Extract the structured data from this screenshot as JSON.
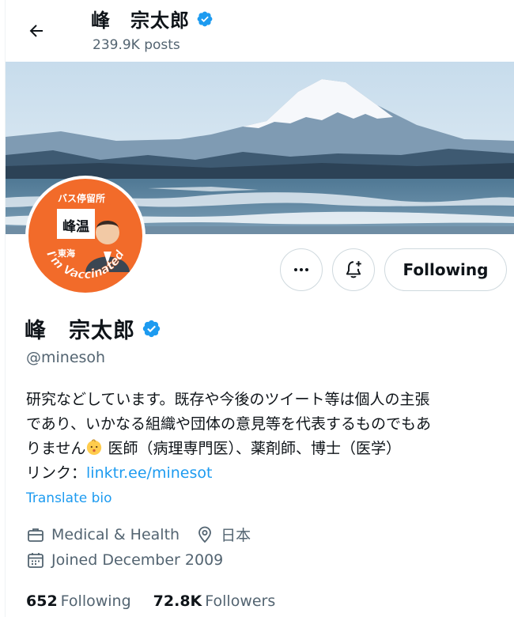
{
  "header": {
    "name": "峰　宗太郎",
    "posts": "239.9K posts"
  },
  "banner": {
    "description": ""
  },
  "avatar": {
    "sign_top": "バス停留所",
    "sign_name": "峰温",
    "sign_sub": "東海",
    "badge": "I'm Vaccinated"
  },
  "actions": {
    "following_label": "Following"
  },
  "profile": {
    "name": "峰　宗太郎",
    "handle": "@minesoh",
    "bio_line1": "研究などしています。既存や今後のツイート等は個人の主張",
    "bio_line2": "であり、いかなる組織や団体の意見等を代表するものでもあ",
    "bio_line3a": "りません",
    "bio_line3b": " 医師（病理専門医）、薬剤師、博士（医学）",
    "bio_line4a": "リンク：",
    "bio_link": "linktr.ee/minesot",
    "translate": "Translate bio",
    "category": "Medical & Health",
    "location": "日本",
    "joined": "Joined December 2009"
  },
  "stats": {
    "following_count": "652",
    "following_label": "Following",
    "followers_count": "72.8K",
    "followers_label": "Followers"
  },
  "colors": {
    "accent": "#1d9bf0",
    "secondary_text": "#536471",
    "avatar_orange": "#f26b2a"
  }
}
